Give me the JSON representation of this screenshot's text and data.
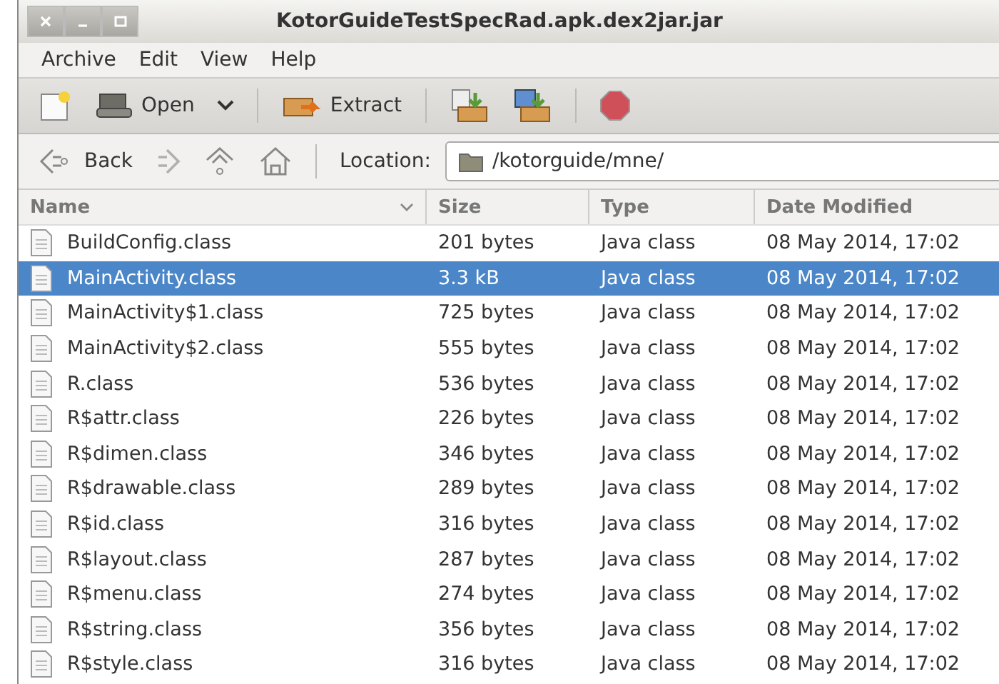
{
  "window": {
    "title": "KotorGuideTestSpecRad.apk.dex2jar.jar"
  },
  "menu": [
    "Archive",
    "Edit",
    "View",
    "Help"
  ],
  "toolbar": {
    "open": "Open",
    "extract": "Extract"
  },
  "location_bar": {
    "back": "Back",
    "label": "Location:",
    "path": "/kotorguide/mne/"
  },
  "table": {
    "columns": [
      "Name",
      "Size",
      "Type",
      "Date Modified"
    ],
    "rows": [
      {
        "name": "BuildConfig.class",
        "size": "201 bytes",
        "type": "Java class",
        "date": "08 May 2014, 17:02",
        "selected": false
      },
      {
        "name": "MainActivity.class",
        "size": "3.3 kB",
        "type": "Java class",
        "date": "08 May 2014, 17:02",
        "selected": true
      },
      {
        "name": "MainActivity$1.class",
        "size": "725 bytes",
        "type": "Java class",
        "date": "08 May 2014, 17:02",
        "selected": false
      },
      {
        "name": "MainActivity$2.class",
        "size": "555 bytes",
        "type": "Java class",
        "date": "08 May 2014, 17:02",
        "selected": false
      },
      {
        "name": "R.class",
        "size": "536 bytes",
        "type": "Java class",
        "date": "08 May 2014, 17:02",
        "selected": false
      },
      {
        "name": "R$attr.class",
        "size": "226 bytes",
        "type": "Java class",
        "date": "08 May 2014, 17:02",
        "selected": false
      },
      {
        "name": "R$dimen.class",
        "size": "346 bytes",
        "type": "Java class",
        "date": "08 May 2014, 17:02",
        "selected": false
      },
      {
        "name": "R$drawable.class",
        "size": "289 bytes",
        "type": "Java class",
        "date": "08 May 2014, 17:02",
        "selected": false
      },
      {
        "name": "R$id.class",
        "size": "316 bytes",
        "type": "Java class",
        "date": "08 May 2014, 17:02",
        "selected": false
      },
      {
        "name": "R$layout.class",
        "size": "287 bytes",
        "type": "Java class",
        "date": "08 May 2014, 17:02",
        "selected": false
      },
      {
        "name": "R$menu.class",
        "size": "274 bytes",
        "type": "Java class",
        "date": "08 May 2014, 17:02",
        "selected": false
      },
      {
        "name": "R$string.class",
        "size": "356 bytes",
        "type": "Java class",
        "date": "08 May 2014, 17:02",
        "selected": false
      },
      {
        "name": "R$style.class",
        "size": "316 bytes",
        "type": "Java class",
        "date": "08 May 2014, 17:02",
        "selected": false
      }
    ]
  }
}
